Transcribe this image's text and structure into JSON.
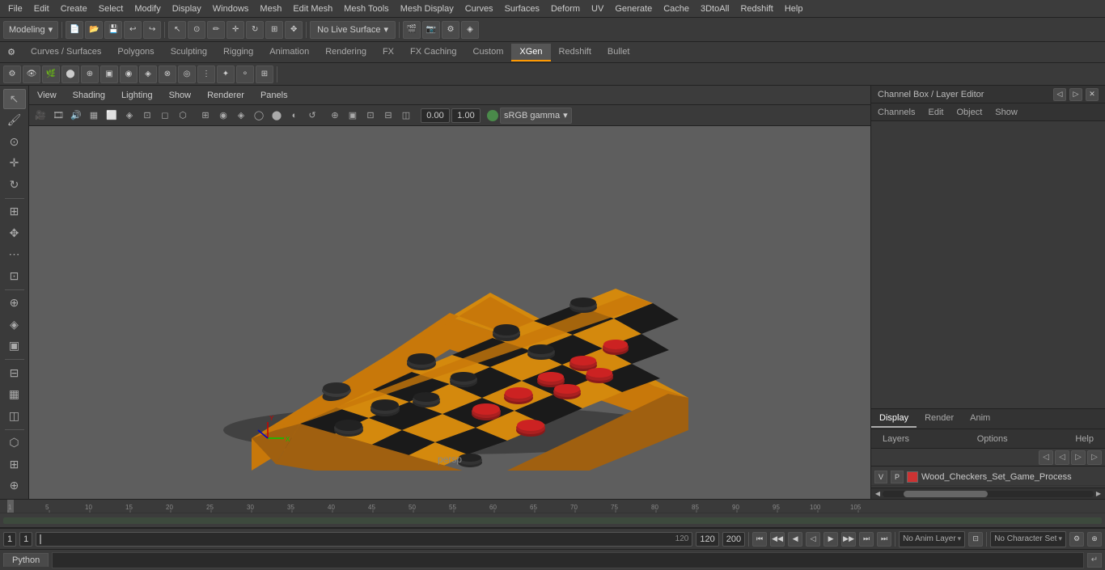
{
  "app": {
    "title": "Autodesk Maya",
    "workspace": "Modeling"
  },
  "menu": {
    "items": [
      "File",
      "Edit",
      "Create",
      "Select",
      "Modify",
      "Display",
      "Windows",
      "Mesh",
      "Edit Mesh",
      "Mesh Tools",
      "Mesh Display",
      "Curves",
      "Surfaces",
      "Deform",
      "UV",
      "Generate",
      "Cache",
      "3DtoAll",
      "Redshift",
      "Help"
    ]
  },
  "toolbar": {
    "workspace_label": "Modeling",
    "live_surface_label": "No Live Surface"
  },
  "tabs": {
    "items": [
      "Curves / Surfaces",
      "Polygons",
      "Sculpting",
      "Rigging",
      "Animation",
      "Rendering",
      "FX",
      "FX Caching",
      "Custom",
      "XGen",
      "Redshift",
      "Bullet"
    ],
    "active": "XGen"
  },
  "viewport": {
    "menus": [
      "View",
      "Shading",
      "Lighting",
      "Show",
      "Renderer",
      "Panels"
    ],
    "camera": "persp",
    "value1": "0.00",
    "value2": "1.00",
    "gamma": "sRGB gamma"
  },
  "channel_box": {
    "title": "Channel Box / Layer Editor",
    "menus": [
      "Channels",
      "Edit",
      "Object",
      "Show"
    ]
  },
  "display_tabs": {
    "items": [
      "Display",
      "Render",
      "Anim"
    ],
    "active": "Display"
  },
  "layers": {
    "label": "Layers",
    "menus": [
      "Layers",
      "Options",
      "Help"
    ],
    "items": [
      {
        "v": "V",
        "p": "P",
        "color": "#cc3333",
        "name": "Wood_Checkers_Set_Game_Process"
      }
    ]
  },
  "timeline": {
    "start": "1",
    "end": "120",
    "current": "1",
    "range_start": "1",
    "range_end": "120",
    "max": "200",
    "anim_layer": "No Anim Layer",
    "character_set": "No Character Set"
  },
  "python": {
    "tab_label": "Python"
  },
  "bottom": {
    "field1": "1",
    "field2": "1",
    "field3": "1",
    "range_end": "120",
    "max_end": "200"
  },
  "icons": {
    "select": "↖",
    "move": "✥",
    "rotate": "↻",
    "scale": "⊞",
    "lasso": "⊙",
    "settings": "⚙",
    "play": "▶",
    "stop": "■",
    "prev": "◀",
    "next": "▶",
    "first": "⏮",
    "last": "⏭",
    "chevron_down": "▾",
    "chevron_right": "▸",
    "close": "✕",
    "expand": "▢",
    "grid": "▦",
    "camera": "📷",
    "eye": "👁",
    "lock": "🔒"
  }
}
